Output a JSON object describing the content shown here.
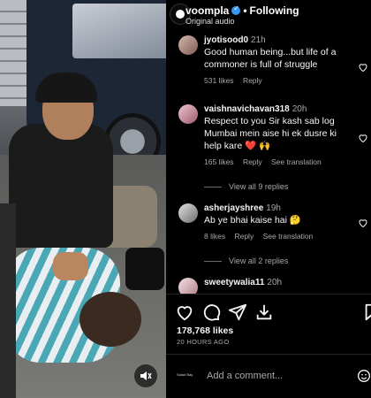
{
  "post": {
    "username": "voompla",
    "separator": "•",
    "follow_label": "Following",
    "audio_label": "Original audio"
  },
  "comments": [
    {
      "user": "jyotisood0",
      "time": "21h",
      "text": "Good human being...but life of a commoner is full of struggle",
      "likes": "531 likes",
      "reply": "Reply",
      "translation": ""
    },
    {
      "user": "vaishnavichavan318",
      "time": "20h",
      "text": "Respect to you Sir kash sab log Mumbai mein aise hi ek dusre ki help kare ❤️ 🙌",
      "likes": "165 likes",
      "reply": "Reply",
      "translation": "See translation",
      "replies": "View all 9 replies"
    },
    {
      "user": "asherjayshree",
      "time": "19h",
      "text": "Ab ye bhai kaise hai 🤔",
      "likes": "8 likes",
      "reply": "Reply",
      "translation": "See translation",
      "replies": "View all 2 replies"
    },
    {
      "user": "sweetywalia11",
      "time": "20h",
      "text": ""
    }
  ],
  "stats": {
    "likes": "178,768 likes",
    "posted": "20 HOURS AGO"
  },
  "composer": {
    "placeholder": "Add a comment...",
    "avatar_text": "Salad Bay"
  },
  "colors": {
    "accent": "#3897f0",
    "heart": "#ed4956",
    "text": "#f5f5f5",
    "muted": "#a8a8a8",
    "background": "#000000"
  },
  "icons": {
    "like": "heart-icon",
    "comment": "comment-icon",
    "share": "share-icon",
    "save": "save-icon",
    "mute": "mute-icon",
    "emoji": "emoji-icon"
  }
}
